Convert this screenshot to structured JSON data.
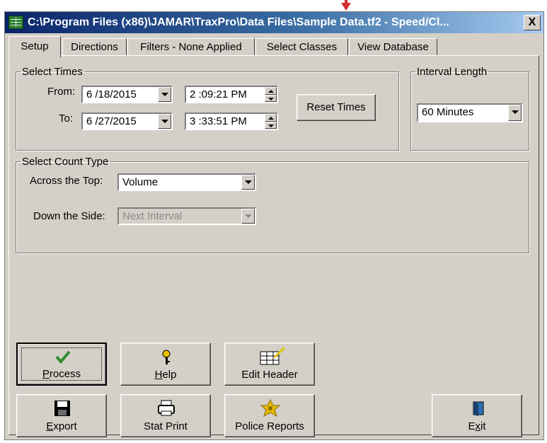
{
  "window": {
    "title": "C:\\Program Files (x86)\\JAMAR\\TraxPro\\Data Files\\Sample Data.tf2 - Speed/Cl...",
    "close_label": "X"
  },
  "tabs": [
    {
      "label": "Setup"
    },
    {
      "label": "Directions"
    },
    {
      "label": "Filters - None Applied"
    },
    {
      "label": "Select Classes"
    },
    {
      "label": "View Database"
    }
  ],
  "select_times": {
    "legend": "Select Times",
    "from_label": "From:",
    "from_date": "6 /18/2015",
    "from_time": "2 :09:21 PM",
    "to_label": "To:",
    "to_date": "6 /27/2015",
    "to_time": "3 :33:51 PM",
    "reset_label": "Reset Times"
  },
  "interval": {
    "legend": "Interval Length",
    "value": "60 Minutes"
  },
  "count_type": {
    "legend": "Select Count Type",
    "across_label": "Across the Top:",
    "across_value": "Volume",
    "down_label": "Down the Side:",
    "down_value": "Next Interval"
  },
  "buttons": {
    "process": {
      "first": "P",
      "rest": "rocess",
      "icon": "check-icon"
    },
    "help": {
      "first": "H",
      "rest": "elp",
      "icon": "key-icon"
    },
    "edit_header": {
      "label": "Edit Header",
      "icon": "edit-header-icon"
    },
    "export": {
      "first": "E",
      "rest": "xport",
      "icon": "floppy-disk-icon"
    },
    "stat_print": {
      "label": "Stat Print",
      "icon": "printer-icon"
    },
    "police_reports": {
      "label": "Police Reports",
      "icon": "police-badge-icon"
    },
    "exit": {
      "pre": "E",
      "u": "x",
      "post": "it",
      "icon": "exit-door-icon"
    }
  },
  "colors": {
    "titlebar_start": "#0a246a",
    "titlebar_end": "#a6caf0",
    "face": "#d4d0c8",
    "arrow_marker": "#d32f2f"
  }
}
